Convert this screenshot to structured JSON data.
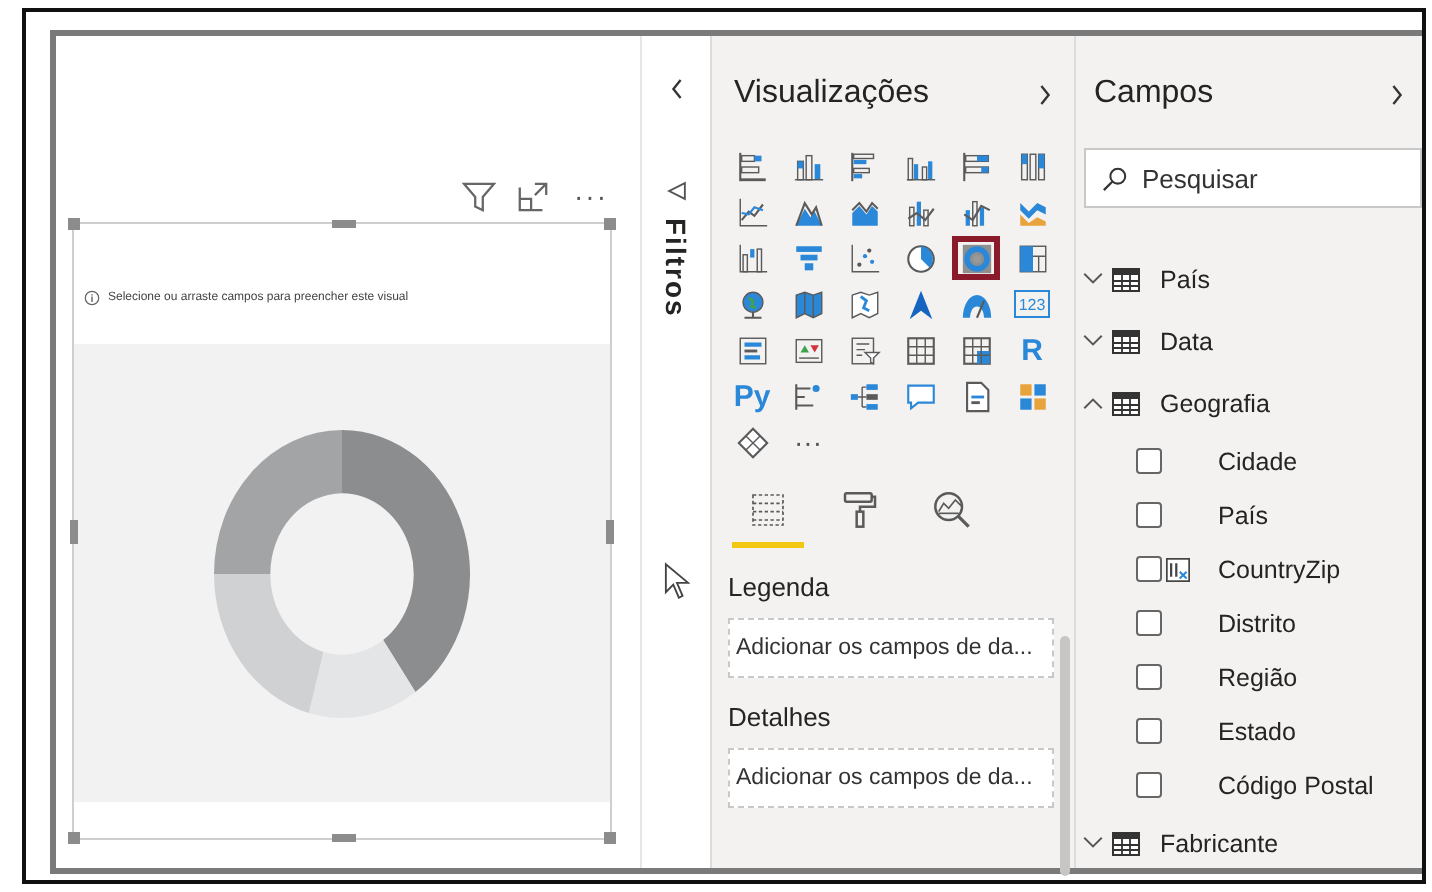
{
  "canvas": {
    "visual_header": {
      "more_label": "···"
    },
    "visual": {
      "hint": "Selecione ou arraste campos para preencher este visual"
    }
  },
  "filters_pane": {
    "title": "Filtros"
  },
  "visualizations_pane": {
    "title": "Visualizações",
    "visuals": [
      {
        "selected": false
      },
      {
        "selected": false
      },
      {
        "selected": false
      },
      {
        "selected": false
      },
      {
        "selected": false
      },
      {
        "selected": false
      },
      {
        "selected": false
      },
      {
        "selected": false
      },
      {
        "selected": false
      },
      {
        "selected": false
      },
      {
        "selected": false
      },
      {
        "selected": false
      },
      {
        "selected": false
      },
      {
        "selected": false
      },
      {
        "selected": false
      },
      {
        "selected": false
      },
      {
        "selected": true
      },
      {
        "selected": false
      },
      {
        "selected": false
      },
      {
        "selected": false
      },
      {
        "selected": false
      },
      {
        "selected": false
      },
      {
        "selected": false
      },
      {
        "label": "123",
        "selected": false
      },
      {
        "selected": false
      },
      {
        "selected": false
      },
      {
        "selected": false
      },
      {
        "selected": false
      },
      {
        "selected": false
      },
      {
        "label": "R",
        "selected": false
      },
      {
        "label": "Py",
        "selected": false
      },
      {
        "selected": false
      },
      {
        "selected": false
      },
      {
        "selected": false
      },
      {
        "selected": false
      },
      {
        "selected": false
      },
      {
        "selected": false
      },
      {
        "label": "···",
        "selected": false
      }
    ],
    "tabs": [
      {
        "selected": true
      },
      {
        "selected": false
      },
      {
        "selected": false
      }
    ],
    "wells": [
      {
        "label": "Legenda",
        "placeholder": "Adicionar os campos de da..."
      },
      {
        "label": "Detalhes",
        "placeholder": "Adicionar os campos de da..."
      }
    ]
  },
  "fields_pane": {
    "title": "Campos",
    "search": {
      "placeholder": "Pesquisar"
    },
    "tables": [
      {
        "name": "País",
        "expanded": false
      },
      {
        "name": "Data",
        "expanded": false
      },
      {
        "name": "Geografia",
        "expanded": true,
        "children": [
          {
            "name": "Cidade",
            "kind": "column",
            "checked": false
          },
          {
            "name": "País",
            "kind": "column",
            "checked": false
          },
          {
            "name": "CountryZip",
            "kind": "calculated",
            "checked": false
          },
          {
            "name": "Distrito",
            "kind": "column",
            "checked": false
          },
          {
            "name": "Região",
            "kind": "column",
            "checked": false
          },
          {
            "name": "Estado",
            "kind": "column",
            "checked": false
          },
          {
            "name": "Código Postal",
            "kind": "column",
            "checked": false
          }
        ]
      },
      {
        "name": "Fabricante",
        "expanded": false
      }
    ]
  }
}
